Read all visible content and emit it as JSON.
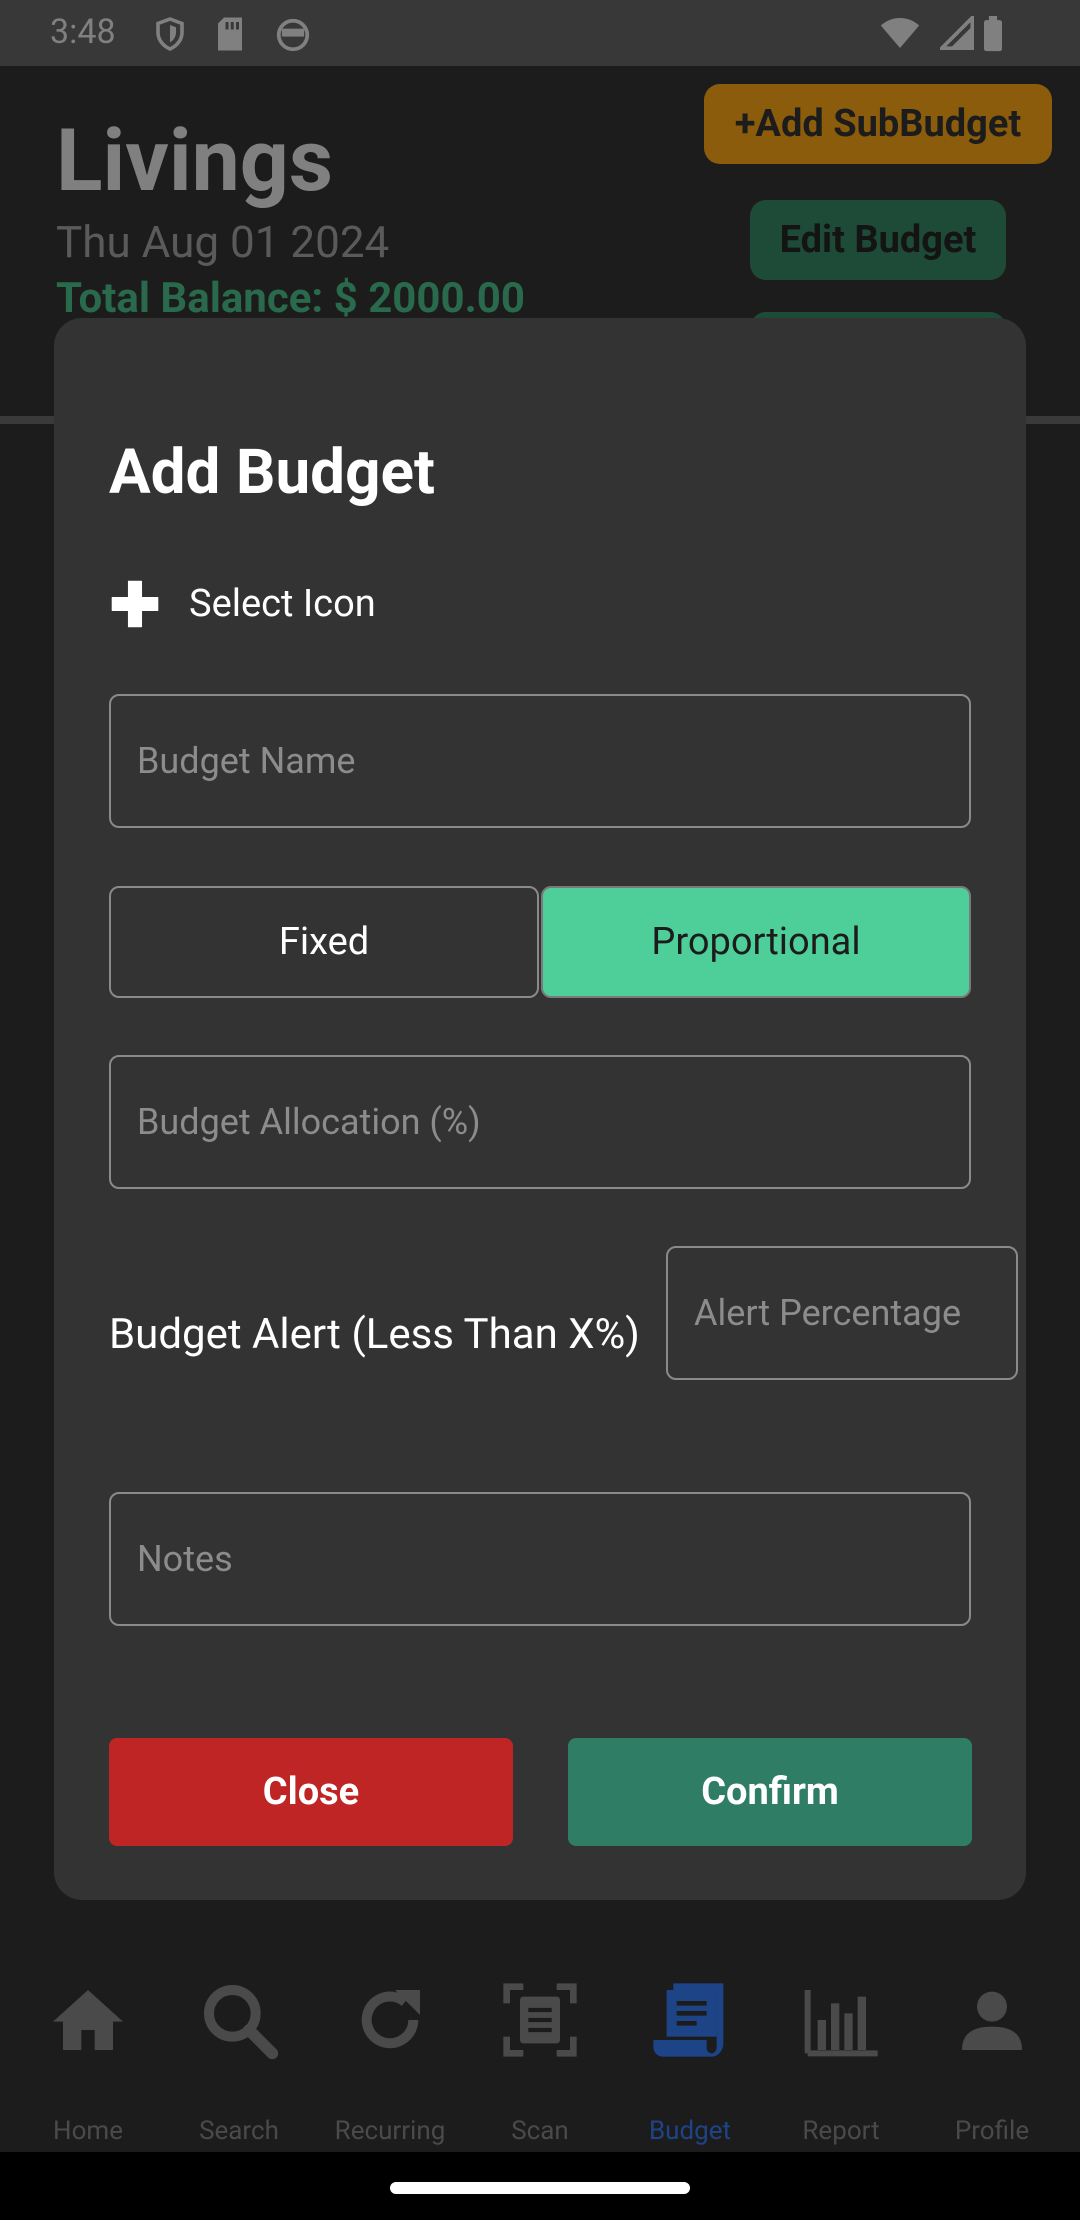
{
  "status_bar": {
    "time": "3:48"
  },
  "background": {
    "title": "Livings",
    "date": "Thu Aug 01 2024",
    "total_balance": "Total Balance: $ 2000.00",
    "add_subbudget_label": "+Add SubBudget",
    "edit_budget_label": "Edit Budget"
  },
  "modal": {
    "title": "Add Budget",
    "select_icon_label": "Select Icon",
    "budget_name_placeholder": "Budget Name",
    "type_fixed_label": "Fixed",
    "type_proportional_label": "Proportional",
    "selected_type": "Proportional",
    "allocation_placeholder": "Budget Allocation (%)",
    "alert_label": "Budget Alert (Less Than X%)",
    "alert_placeholder": "Alert Percentage",
    "notes_placeholder": "Notes",
    "close_label": "Close",
    "confirm_label": "Confirm"
  },
  "bottom_nav": {
    "items": [
      {
        "label": "Home",
        "icon": "home-icon"
      },
      {
        "label": "Search",
        "icon": "search-icon"
      },
      {
        "label": "Recurring",
        "icon": "refresh-icon"
      },
      {
        "label": "Scan",
        "icon": "scan-receipt-icon"
      },
      {
        "label": "Budget",
        "icon": "budget-receipt-icon",
        "active": true
      },
      {
        "label": "Report",
        "icon": "bar-chart-icon"
      },
      {
        "label": "Profile",
        "icon": "person-icon"
      }
    ]
  },
  "colors": {
    "accent_green": "#4ecf9a",
    "confirm_green": "#2e7d64",
    "close_red": "#c02525",
    "modal_bg": "#333333",
    "active_nav": "#1e4488"
  }
}
